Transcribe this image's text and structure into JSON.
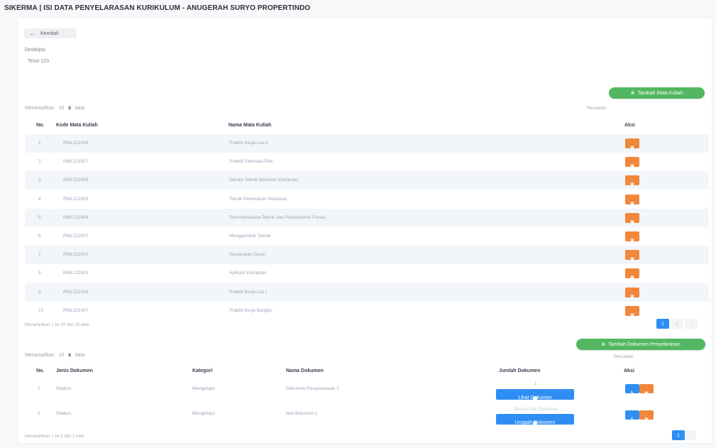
{
  "page_title": "SIKERMA | ISI DATA PENYELARASAN KURIKULUM - ANUGERAH SURYO PROPERTINDO",
  "back_button": {
    "icon": "arrow-left-icon",
    "label": "Kembali"
  },
  "description": {
    "label": "Deskripsi",
    "value": "Tesst 123"
  },
  "courses": {
    "add_button": "Tambah Mata Kuliah",
    "show_prefix": "Menampilkan",
    "show_value": "10",
    "show_count_current": "8",
    "show_suffix": "data",
    "search_label": "Pencarian:",
    "headers": {
      "no": "No.",
      "code": "Kode Mata Kuliah",
      "name": "Nama Mata Kuliah",
      "action": "Aksi"
    },
    "rows": [
      {
        "no": "1",
        "code": "RML222006",
        "name": "Praktik Kerja Las II"
      },
      {
        "no": "2",
        "code": "RML222007",
        "name": "Praktik Fabrikasi Plat"
      },
      {
        "no": "3",
        "code": "RML222005",
        "name": "Desain Teknik Berbasis Komputer"
      },
      {
        "no": "4",
        "code": "RML222005",
        "name": "Teknik Pemesinan Perkakas"
      },
      {
        "no": "5",
        "code": "RML222004",
        "name": "Termodinamika Teknik dan Perpindahan Panas"
      },
      {
        "no": "6",
        "code": "RML222007",
        "name": "Menggambar Teknik"
      },
      {
        "no": "7",
        "code": "RML222002",
        "name": "Kecakapan Dasar"
      },
      {
        "no": "8",
        "code": "RML222001",
        "name": "Aplikasi Komputer"
      },
      {
        "no": "9",
        "code": "RML221006",
        "name": "Praktik Kerja Las I"
      },
      {
        "no": "10",
        "code": "RML221007",
        "name": "Praktik Kerja Bangku"
      }
    ],
    "action_icon": "trash-icon",
    "footer": "Menampilkan 1 ke 10 dari 10 data",
    "pagination": {
      "active": "1",
      "pages": [
        "1",
        "2",
        "›"
      ]
    }
  },
  "documents": {
    "add_button": "Tambah Dokumen Penyelarasan",
    "show_prefix": "Menampilkan",
    "show_value": "10",
    "show_count_current": "8",
    "show_suffix": "data",
    "search_label": "Pencarian:",
    "headers": {
      "no": "No.",
      "type": "Jenis Dokumen",
      "category": "Kategori",
      "name": "Nama Dokumen",
      "count": "Jumlah Dokumen",
      "action": "Aksi"
    },
    "rows": [
      {
        "no": "1",
        "type": "Silabus",
        "category": "Mengetujui",
        "name": "Dokumen Penyelarasan 1",
        "count": "1",
        "doc_button": "Lihat Dokumen",
        "doc_icon": "folder-icon"
      },
      {
        "no": "2",
        "type": "Silabus",
        "category": "Mengetujui",
        "name": "test dokumen 1",
        "count": "Belum Ada Dokumen",
        "doc_button": "Unggah Dokumen",
        "doc_icon": "upload-icon"
      }
    ],
    "edit_icon": "pencil-icon",
    "delete_icon": "trash-icon",
    "footer": "Menampilkan 1 ke 2 dari 2 data",
    "pagination": {
      "active": "1",
      "pages": [
        "1"
      ]
    }
  },
  "colors": {
    "green": "#52b760",
    "orange": "#f0873b",
    "blue": "#2f8ef4"
  }
}
